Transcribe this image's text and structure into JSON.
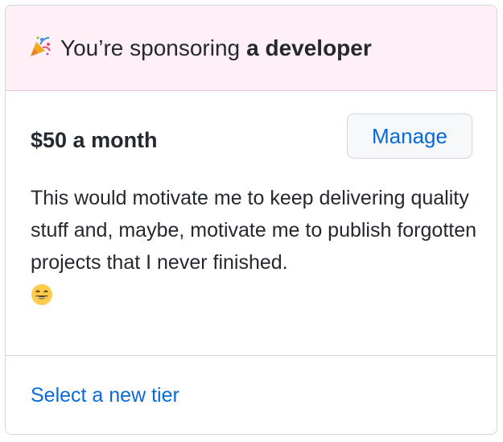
{
  "header": {
    "icon": "party-popper-icon",
    "text_prefix": "You’re sponsoring",
    "text_strong": "a developer"
  },
  "tier": {
    "price_label": "$50 a month",
    "manage_label": "Manage",
    "description": "This would motivate me to keep delivering quality stuff and, maybe, motivate me to publish forgotten projects that I never finished.",
    "description_emoji": "grinning-face-icon"
  },
  "footer": {
    "link_label": "Select a new tier"
  },
  "colors": {
    "header_bg": "#ffeff7",
    "header_border": "#f1bcd9",
    "link": "#0969da",
    "text": "#24292f",
    "border": "#d0d7de"
  }
}
